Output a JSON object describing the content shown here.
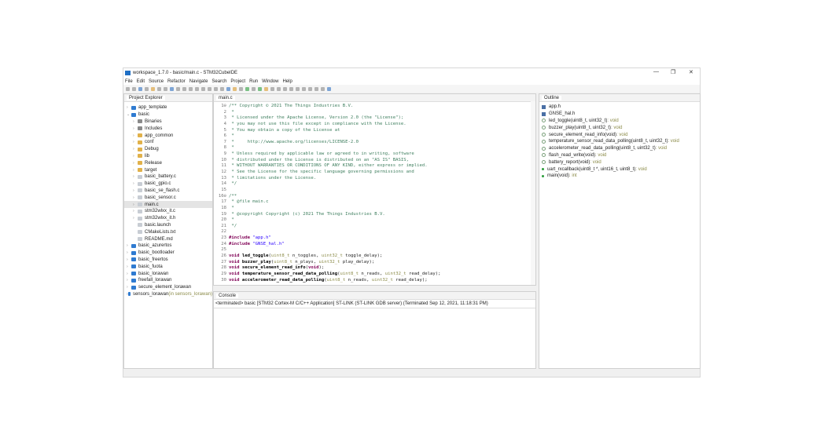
{
  "window": {
    "title": "workspace_1.7.0 - basic/main.c - STM32CubeIDE",
    "controls": [
      "—",
      "❐",
      "✕"
    ]
  },
  "menu": [
    "File",
    "Edit",
    "Source",
    "Refactor",
    "Navigate",
    "Search",
    "Project",
    "Run",
    "Window",
    "Help"
  ],
  "project_explorer": {
    "title": "Project Explorer",
    "items": [
      {
        "label": "app_template",
        "type": "proj",
        "depth": 0,
        "arrow": "›"
      },
      {
        "label": "basic",
        "type": "proj",
        "depth": 0,
        "arrow": "⌄"
      },
      {
        "label": "Binaries",
        "type": "bin",
        "depth": 1,
        "arrow": "›"
      },
      {
        "label": "Includes",
        "type": "bin",
        "depth": 1,
        "arrow": "›"
      },
      {
        "label": "app_common",
        "type": "fold",
        "depth": 1,
        "arrow": "›"
      },
      {
        "label": "conf",
        "type": "fold",
        "depth": 1,
        "arrow": "›"
      },
      {
        "label": "Debug",
        "type": "fold",
        "depth": 1,
        "arrow": "›"
      },
      {
        "label": "lib",
        "type": "fold",
        "depth": 1,
        "arrow": "›"
      },
      {
        "label": "Release",
        "type": "fold",
        "depth": 1,
        "arrow": "›"
      },
      {
        "label": "target",
        "type": "fold",
        "depth": 1,
        "arrow": "›"
      },
      {
        "label": "basic_battery.c",
        "type": "file",
        "depth": 1,
        "arrow": "›"
      },
      {
        "label": "basic_gpio.c",
        "type": "file",
        "depth": 1,
        "arrow": "›"
      },
      {
        "label": "basic_se_flash.c",
        "type": "file",
        "depth": 1,
        "arrow": "›"
      },
      {
        "label": "basic_sensor.c",
        "type": "file",
        "depth": 1,
        "arrow": "›"
      },
      {
        "label": "main.c",
        "type": "file",
        "depth": 1,
        "arrow": "›",
        "selected": true
      },
      {
        "label": "stm32wlxx_it.c",
        "type": "file",
        "depth": 1,
        "arrow": "›"
      },
      {
        "label": "stm32wlxx_it.h",
        "type": "file",
        "depth": 1,
        "arrow": "›"
      },
      {
        "label": "basic.launch",
        "type": "file",
        "depth": 1,
        "arrow": ""
      },
      {
        "label": "CMakeLists.txt",
        "type": "file",
        "depth": 1,
        "arrow": ""
      },
      {
        "label": "README.md",
        "type": "file",
        "depth": 1,
        "arrow": ""
      },
      {
        "label": "basic_azurertos",
        "type": "proj",
        "depth": 0,
        "arrow": "›"
      },
      {
        "label": "basic_bootloader",
        "type": "proj",
        "depth": 0,
        "arrow": "›"
      },
      {
        "label": "basic_freertos",
        "type": "proj",
        "depth": 0,
        "arrow": "›"
      },
      {
        "label": "basic_fuota",
        "type": "proj",
        "depth": 0,
        "arrow": "›"
      },
      {
        "label": "basic_lorawan",
        "type": "proj",
        "depth": 0,
        "arrow": "›"
      },
      {
        "label": "freefall_lorawan",
        "type": "proj",
        "depth": 0,
        "arrow": "›"
      },
      {
        "label": "secure_element_lorawan",
        "type": "proj",
        "depth": 0,
        "arrow": "›"
      },
      {
        "label": "sensors_lorawan",
        "type": "proj",
        "depth": 0,
        "arrow": "›",
        "suffix": " (in sensors_lorawan)"
      }
    ]
  },
  "editor": {
    "tab": "main.c",
    "lines": [
      [
        [
          "/** Copyright © 2021 The Things Industries B.V.",
          "cm"
        ]
      ],
      [
        [
          " *",
          "cm"
        ]
      ],
      [
        [
          " * Licensed under the Apache License, Version 2.0 (the \"License\");",
          "cm"
        ]
      ],
      [
        [
          " * you may not use this file except in compliance with the License.",
          "cm"
        ]
      ],
      [
        [
          " * You may obtain a copy of the License at",
          "cm"
        ]
      ],
      [
        [
          " *",
          "cm"
        ]
      ],
      [
        [
          " *     http://www.apache.org/licenses/LICENSE-2.0",
          "cm"
        ]
      ],
      [
        [
          " *",
          "cm"
        ]
      ],
      [
        [
          " * Unless required by applicable law or agreed to in writing, software",
          "cm"
        ]
      ],
      [
        [
          " * distributed under the License is distributed on an \"AS IS\" BASIS,",
          "cm"
        ]
      ],
      [
        [
          " * WITHOUT WARRANTIES OR CONDITIONS OF ANY KIND, either express or implied.",
          "cm"
        ]
      ],
      [
        [
          " * See the License for the specific language governing permissions and",
          "cm"
        ]
      ],
      [
        [
          " * limitations under the License.",
          "cm"
        ]
      ],
      [
        [
          " */",
          "cm"
        ]
      ],
      [],
      [
        [
          "/**",
          "cm"
        ]
      ],
      [
        [
          " * @file main.c",
          "cm"
        ]
      ],
      [
        [
          " *",
          "cm"
        ]
      ],
      [
        [
          " * @copyright Copyright (c) 2021 The Things Industries B.V.",
          "cm"
        ]
      ],
      [
        [
          " *",
          "cm"
        ]
      ],
      [
        [
          " */",
          "cm"
        ]
      ],
      [],
      [
        [
          "#include ",
          "kw"
        ],
        [
          "\"app.h\"",
          "st"
        ]
      ],
      [
        [
          "#include ",
          "kw"
        ],
        [
          "\"GNSE_hal.h\"",
          "st"
        ]
      ],
      [],
      [
        [
          "void ",
          "kw"
        ],
        [
          "led_toggle",
          "fn"
        ],
        [
          "(",
          ""
        ],
        [
          "uint8_t",
          "ty"
        ],
        [
          " n_toggles, ",
          ""
        ],
        [
          "uint32_t",
          "ty"
        ],
        [
          " toggle_delay);",
          ""
        ]
      ],
      [
        [
          "void ",
          "kw"
        ],
        [
          "buzzer_play",
          "fn"
        ],
        [
          "(",
          ""
        ],
        [
          "uint8_t",
          "ty"
        ],
        [
          " n_plays, ",
          ""
        ],
        [
          "uint32_t",
          "ty"
        ],
        [
          " play_delay);",
          ""
        ]
      ],
      [
        [
          "void ",
          "kw"
        ],
        [
          "secure_element_read_info",
          "fn"
        ],
        [
          "(",
          ""
        ],
        [
          "void",
          "kw"
        ],
        [
          ");",
          ""
        ]
      ],
      [
        [
          "void ",
          "kw"
        ],
        [
          "temperature_sensor_read_data_polling",
          "fn"
        ],
        [
          "(",
          ""
        ],
        [
          "uint8_t",
          "ty"
        ],
        [
          " n_reads, ",
          ""
        ],
        [
          "uint32_t",
          "ty"
        ],
        [
          " read_delay);",
          ""
        ]
      ],
      [
        [
          "void ",
          "kw"
        ],
        [
          "accelerometer_read_data_polling",
          "fn"
        ],
        [
          "(",
          ""
        ],
        [
          "uint8_t",
          "ty"
        ],
        [
          " n_reads, ",
          ""
        ],
        [
          "uint32_t",
          "ty"
        ],
        [
          " read_delay);",
          ""
        ]
      ]
    ]
  },
  "console": {
    "title": "Console",
    "text": "<terminated> basic [STM32 Cortex-M C/C++ Application] ST-LINK (ST-LINK GDB server) (Terminated Sep 12, 2021, 11:18:31 PM)"
  },
  "outline": {
    "title": "Outline",
    "items": [
      {
        "name": "app.h",
        "type": "",
        "kind": "include"
      },
      {
        "name": "GNSE_hal.h",
        "type": "",
        "kind": "include"
      },
      {
        "name": "led_toggle(uint8_t, uint32_t)",
        "type": " : void",
        "kind": "decl"
      },
      {
        "name": "buzzer_play(uint8_t, uint32_t)",
        "type": " : void",
        "kind": "decl"
      },
      {
        "name": "secure_element_read_info(void)",
        "type": " : void",
        "kind": "decl"
      },
      {
        "name": "temperature_sensor_read_data_polling(uint8_t, uint32_t)",
        "type": " : void",
        "kind": "decl"
      },
      {
        "name": "accelerometer_read_data_polling(uint8_t, uint32_t)",
        "type": " : void",
        "kind": "decl"
      },
      {
        "name": "flash_read_write(void)",
        "type": " : void",
        "kind": "decl"
      },
      {
        "name": "battery_report(void)",
        "type": " : void",
        "kind": "decl"
      },
      {
        "name": "uart_rxcallback(uint8_t *, uint16_t, uint8_t)",
        "type": " : void",
        "kind": "fn"
      },
      {
        "name": "main(void)",
        "type": " : int",
        "kind": "fn"
      }
    ]
  }
}
